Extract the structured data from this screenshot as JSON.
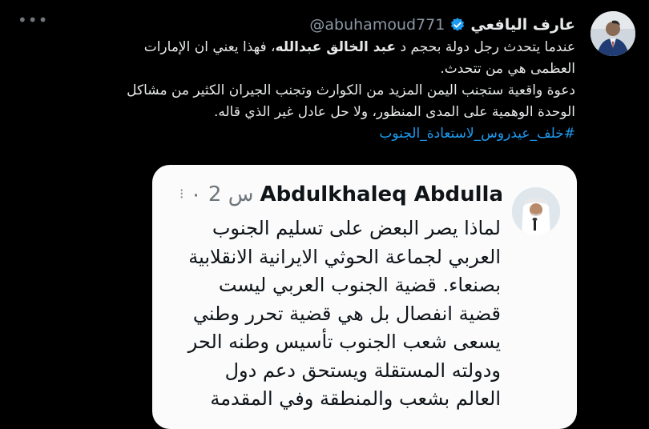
{
  "tweet": {
    "author_name": "عارف اليافعي",
    "handle": "@abuhamoud771",
    "more_icon": "more-icon",
    "lines": [
      [
        "عندما يتحدث رجل دولة بحجم د ",
        "عبد الخالق عبدالله",
        "، فهذا يعني ان الإمارات"
      ],
      "العظمى هي من تتحدث.",
      "دعوة واقعية ستجنب اليمن المزيد من الكوارث وتجنب الجيران الكثير من مشاكل",
      "الوحدة الوهمية على المدى المنظور، ولا حل عادل غير الذي قاله."
    ],
    "hashtag": "#خلف_عيدروس_لاستعادة_الجنوب"
  },
  "quote": {
    "author_name": "Abdulkhaleq Abdulla",
    "time": "٠ 2 س",
    "more": "⁝",
    "lines": [
      "لماذا يصر البعض على تسليم الجنوب",
      "العربي لجماعة الحوثي الايرانية الانقلابية",
      "بصنعاء. قضية الجنوب العربي ليست",
      "قضية انفصال بل هي قضية تحرر وطني",
      "يسعى شعب الجنوب تأسيس وطنه الحر",
      "ودولته المستقلة ويستحق دعم دول",
      "العالم بشعب والمنطقة وفي المقدمة"
    ]
  },
  "colors": {
    "link": "#1d9bf0",
    "verified": "#1d9bf0",
    "background": "#000000"
  }
}
